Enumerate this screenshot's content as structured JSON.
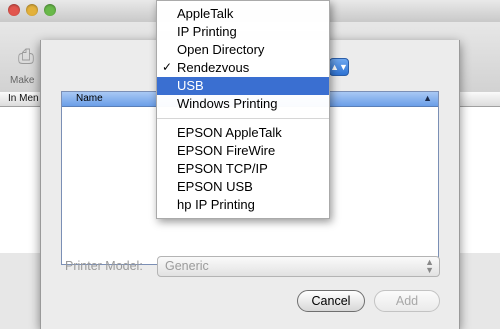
{
  "back_window": {
    "toolbar_item": "Make",
    "list_header": "In Men"
  },
  "sheet": {
    "table_header": "Name",
    "model_label": "Printer Model:",
    "model_value": "Generic",
    "cancel": "Cancel",
    "add": "Add"
  },
  "menu": {
    "items": [
      {
        "label": "AppleTalk"
      },
      {
        "label": "IP Printing"
      },
      {
        "label": "Open Directory"
      },
      {
        "label": "Rendezvous",
        "checked": "✓"
      },
      {
        "label": "USB",
        "selected": true
      },
      {
        "label": "Windows Printing"
      },
      {
        "label": "EPSON AppleTalk"
      },
      {
        "label": "EPSON FireWire"
      },
      {
        "label": "EPSON TCP/IP"
      },
      {
        "label": "EPSON USB"
      },
      {
        "label": "hp IP Printing"
      }
    ]
  },
  "colors": {
    "selection": "#3a6fd1",
    "table_header": "#6b9ee8"
  }
}
